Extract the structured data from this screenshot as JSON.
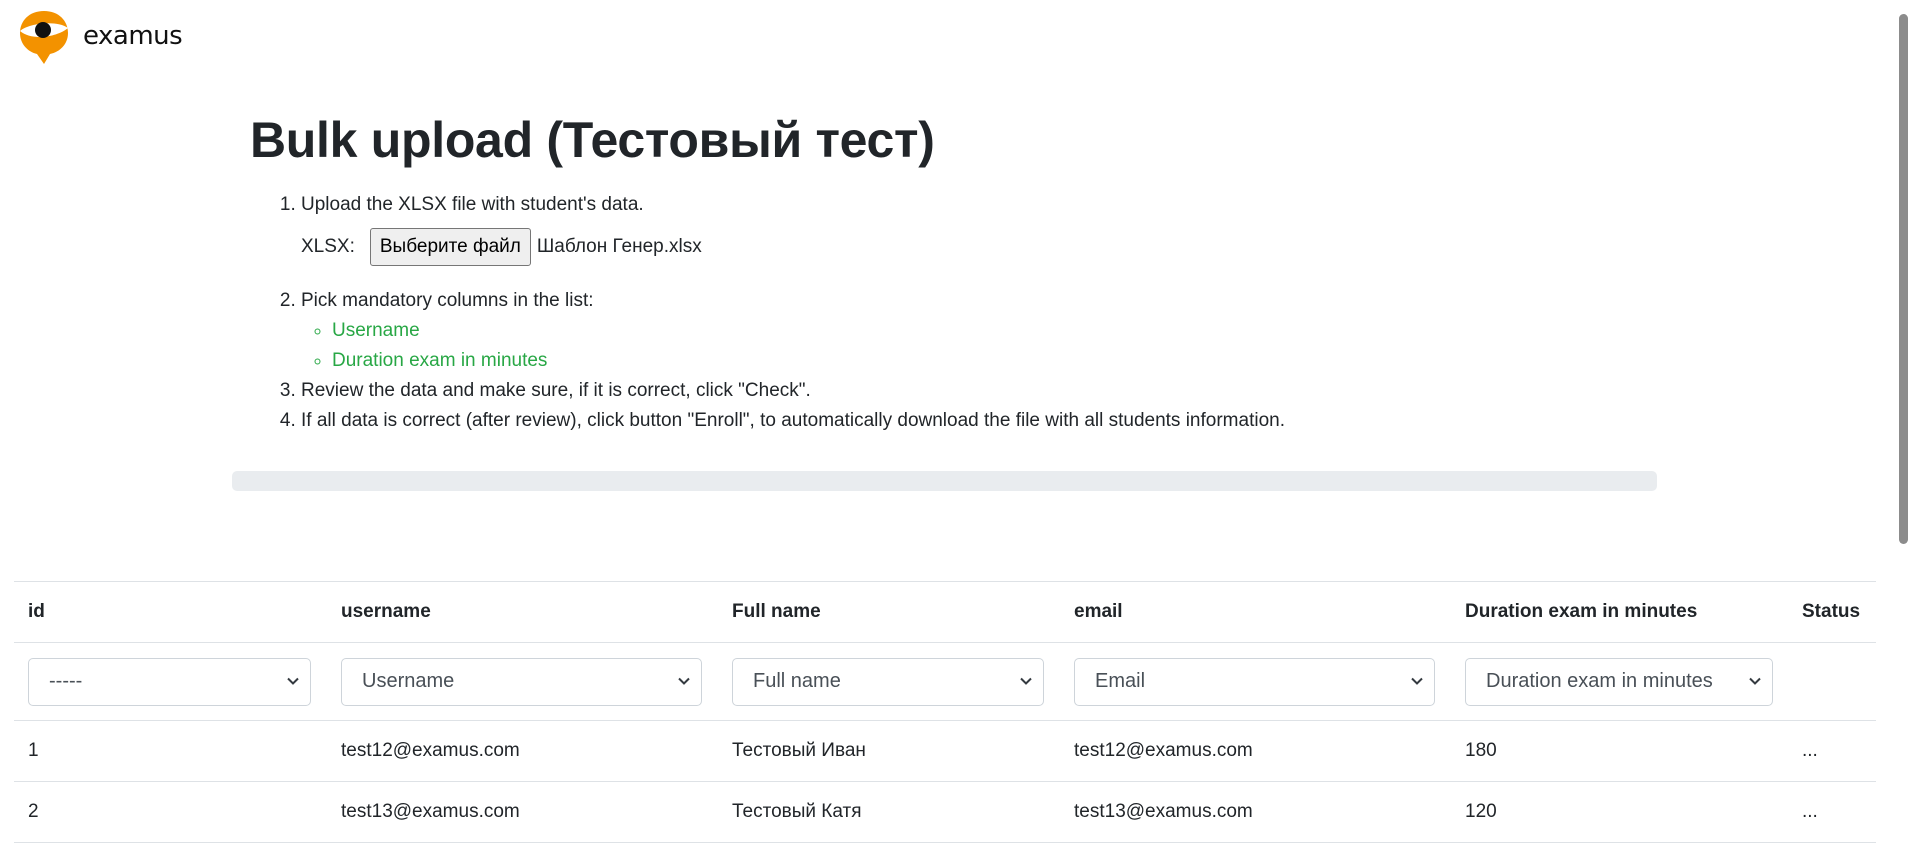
{
  "brand": {
    "name": "examus",
    "logo_color": "#f39200"
  },
  "page": {
    "title": "Bulk upload (Тестовый тест)",
    "steps": {
      "step1": "Upload the XLSX file with student's data.",
      "xlsx_label": "XLSX:",
      "file_button": "Выберите файл",
      "file_name": "Шаблон Генер.xlsx",
      "step2": "Pick mandatory columns in the list:",
      "mandatory_columns": [
        "Username",
        "Duration exam in minutes"
      ],
      "step3": "Review the data and make sure, if it is correct, click \"Check\".",
      "step4": "If all data is correct (after review), click button \"Enroll\", to automatically download the file with all students information."
    },
    "progress_value": 0
  },
  "table": {
    "headers": [
      "id",
      "username",
      "Full name",
      "email",
      "Duration exam in minutes",
      "Status"
    ],
    "filters": [
      "-----",
      "Username",
      "Full name",
      "Email",
      "Duration exam in minutes"
    ],
    "rows": [
      [
        "1",
        "test12@examus.com",
        "Тестовый Иван",
        "test12@examus.com",
        "180",
        "..."
      ],
      [
        "2",
        "test13@examus.com",
        "Тестовый Катя",
        "test13@examus.com",
        "120",
        "..."
      ]
    ]
  },
  "colors": {
    "accent_green": "#28a745",
    "text": "#212529",
    "border": "#dee2e6"
  }
}
